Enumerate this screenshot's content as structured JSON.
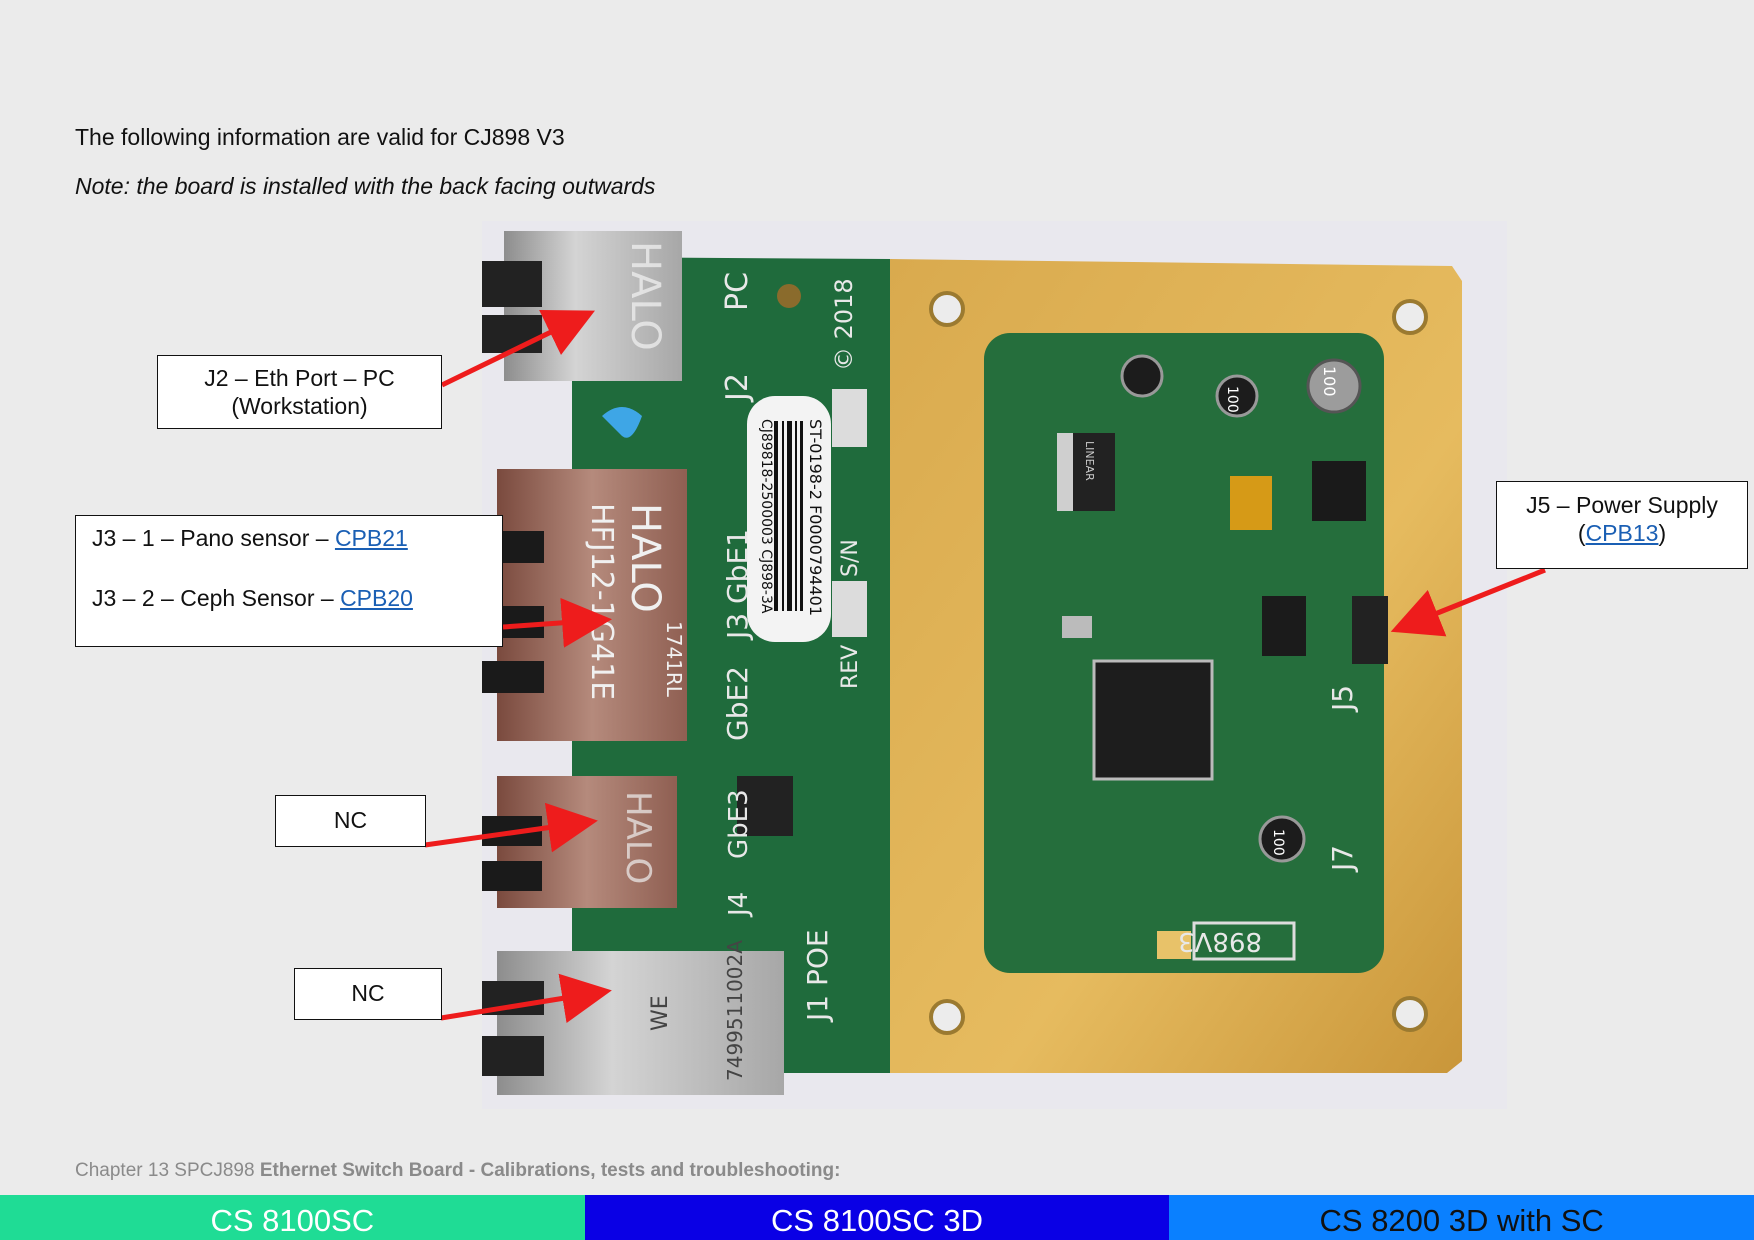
{
  "intro": "The following information are valid for CJ898 V3",
  "note": "Note: the board is installed with the back facing outwards",
  "board_labels": {
    "pc": "PC",
    "j2": "J2",
    "copyright": "© 2018",
    "gbe1": "J3 GbE1",
    "gbe2": "GbE2",
    "gbe3": "GbE3",
    "j4": "J4",
    "poe": "J1 POE",
    "sn": "S/N",
    "rev": "REV",
    "serial1": "ST-0198-2 F0000794401",
    "serial2": "CJ89818-2500003 CJ898-3A",
    "halo1": "HALO",
    "halo2": "HALO",
    "halo3": "HALO",
    "hfj": "HFJ12-1G41E",
    "code1741": "1741RL",
    "we": "WE",
    "we_code": "7499511002A",
    "j5": "J5",
    "j7": "J7",
    "version": "898V3",
    "cap100a": "100",
    "cap100b": "100",
    "cap100c": "100",
    "linear": "LINEAR"
  },
  "callouts": {
    "j2": "J2 – Eth Port – PC",
    "j2_sub": "(Workstation)",
    "j3_1_prefix": "J3 – 1 – Pano sensor – ",
    "j3_1_link": "CPB21",
    "j3_2_prefix": "J3 – 2 – Ceph Sensor – ",
    "j3_2_link": "CPB20",
    "nc1": "NC",
    "nc2": "NC",
    "j5": "J5 – Power Supply",
    "j5_open": "(",
    "j5_link": "CPB13",
    "j5_close": ")"
  },
  "footer": {
    "chapter": "Chapter 13 SPCJ898 ",
    "title": "Ethernet Switch Board - Calibrations, tests and troubleshooting:"
  },
  "tabs": [
    "CS 8100SC",
    "CS 8100SC 3D",
    "CS 8200 3D with SC"
  ],
  "colors": {
    "tab1": "#1fdc95",
    "tab2": "#0a00e5",
    "tab3": "#0a80ff",
    "arrow": "#ee1c1c",
    "link": "#1a5fb4"
  }
}
